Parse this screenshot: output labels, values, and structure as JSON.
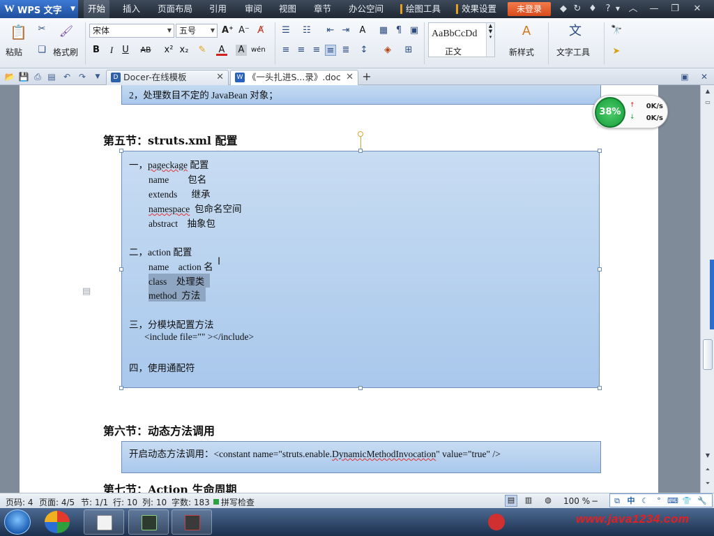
{
  "app": {
    "name": "WPS 文字"
  },
  "menu": {
    "items": [
      "开始",
      "插入",
      "页面布局",
      "引用",
      "审阅",
      "视图",
      "章节",
      "办公空间"
    ],
    "drawing_tools": "绘图工具",
    "effects": "效果设置",
    "login": "未登录"
  },
  "ribbon": {
    "paste": "粘贴",
    "format_painter": "格式刷",
    "font_name": "宋体",
    "font_size": "五号",
    "style_sample": "AaBbCcDd",
    "style_name": "正文",
    "new_style": "新样式",
    "text_tools": "文字工具",
    "bold": "B",
    "italic": "I",
    "underline": "U"
  },
  "tabs": [
    {
      "label": "Docer-在线模板",
      "active": false
    },
    {
      "label": "《一头扎进S...录》.doc",
      "active": true
    }
  ],
  "document": {
    "top_box_line": "2，处理数目不定的 JavaBean 对象；",
    "section5_title": "第五节：struts.xml 配置",
    "box5": {
      "l1_pre": "一，",
      "l1_a": "pageckage",
      "l1_b": " 配置",
      "l2": "name        包名",
      "l3": "extends      继承",
      "l4_a": "namespace",
      "l4_b": "  包命名空间",
      "l5": "abstract    抽象包",
      "l6": "二，action 配置",
      "l7": "name    action 名",
      "l8": "class    处理类",
      "l9": "method  方法",
      "l10": "三，分模块配置方法",
      "l11": "<include file=\"\" ></include>",
      "l12": "四，使用通配符"
    },
    "section6_title": "第六节：动态方法调用",
    "box6_a": "开启动态方法调用：<constant name=\"struts.enable.",
    "box6_b": "DynamicMethodInvocation",
    "box6_c": "\" value=\"true\" />",
    "section7_title": "第七节：Action 生命周期"
  },
  "speed_widget": {
    "percent": "38%",
    "up": "0K/s",
    "down": "0K/s"
  },
  "status": {
    "page_no": "页码: 4",
    "pages": "页面: 4/5",
    "section": "节: 1/1",
    "row": "行: 10",
    "col": "列: 10",
    "words": "字数: 183",
    "spell": "拼写检查",
    "zoom": "100 %"
  },
  "ime": {
    "lang": "中"
  },
  "watermark": "www.java1234.com",
  "colors": {
    "accent": "#2a6fd0",
    "login": "#e25a2a",
    "textbox": "#b3cfee"
  }
}
